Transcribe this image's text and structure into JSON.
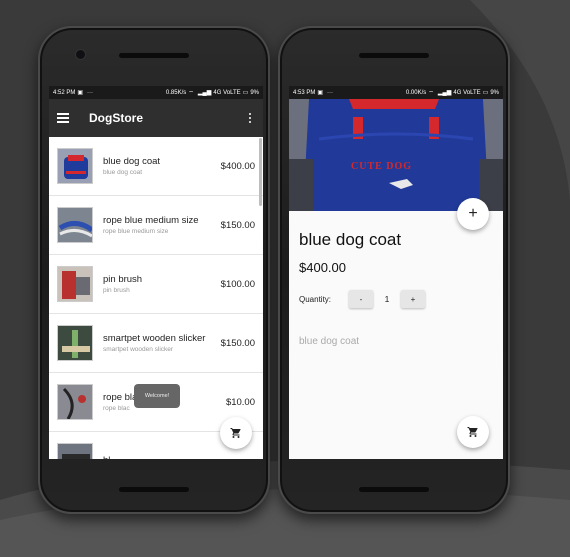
{
  "colors": {
    "toolbar": "#2f2f2f",
    "statusbar": "#1a1a1a",
    "background": "#3a3a3a"
  },
  "left_phone": {
    "status": {
      "time": "4:52 PM",
      "speed": "0.85K/s",
      "network": "4G VoLTE",
      "battery": "9%"
    },
    "toolbar": {
      "title": "DogStore",
      "menu_icon": "hamburger-icon",
      "overflow_icon": "more-vert-icon"
    },
    "products": [
      {
        "name": "blue dog coat",
        "desc": "blue dog coat",
        "price": "$400.00"
      },
      {
        "name": "rope blue medium size",
        "desc": "rope blue medium size",
        "price": "$150.00"
      },
      {
        "name": "pin brush",
        "desc": "pin brush",
        "price": "$100.00"
      },
      {
        "name": "smartpet wooden slicker",
        "desc": "smartpet wooden slicker",
        "price": "$150.00"
      },
      {
        "name": "rope bla",
        "desc": "rope blac",
        "price": "$10.00"
      },
      {
        "name": "bl",
        "desc": "",
        "price": ""
      }
    ],
    "toast": "Welcome!",
    "cart_icon": "cart-icon"
  },
  "right_phone": {
    "status": {
      "time": "4:53 PM",
      "speed": "0.00K/s",
      "network": "4G VoLTE",
      "battery": "9%"
    },
    "hero_text": "CUTE DOG",
    "product": {
      "title": "blue dog coat",
      "price": "$400.00",
      "quantity_label": "Quantity:",
      "minus_label": "-",
      "quantity": "1",
      "plus_label": "+",
      "description": "blue dog coat"
    },
    "add_icon": "plus-icon",
    "cart_icon": "cart-icon"
  }
}
